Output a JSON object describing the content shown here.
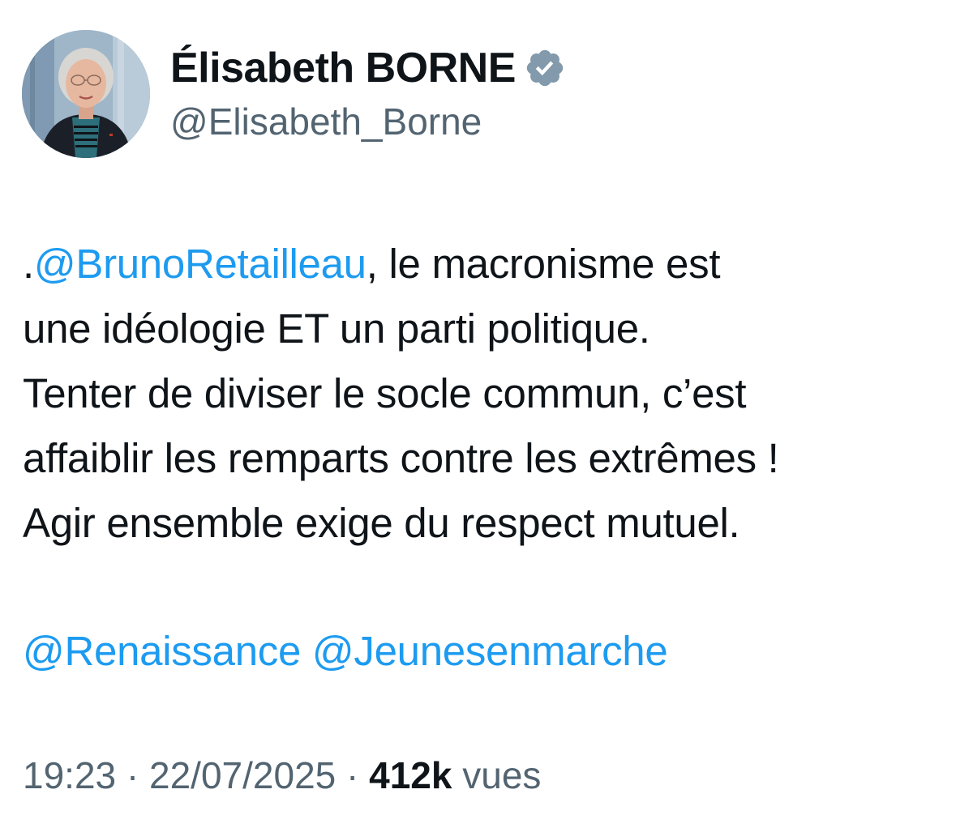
{
  "author": {
    "name": "Élisabeth BORNE",
    "handle": "@Elisabeth_Borne",
    "verified_icon": "verified-badge-icon",
    "verified_color": "#829aab"
  },
  "tweet": {
    "prefix": ".",
    "mention_1": "@BrunoRetailleau",
    "line_1_rest": ", le macronisme est",
    "line_2": "une idéologie ET un parti politique.",
    "line_3": "Tenter de diviser le socle commun, c’est",
    "line_4": "affaiblir les remparts contre les extrêmes !",
    "line_5": "Agir ensemble exige du respect mutuel.",
    "mention_2": "@Renaissance",
    "mention_3": "@Jeunesenmarche"
  },
  "meta": {
    "time": "19:23",
    "separator": "·",
    "date": "22/07/2025",
    "views_count": "412k",
    "views_label": "vues"
  },
  "colors": {
    "mention": "#1d9bf0",
    "text": "#0f1419",
    "secondary": "#536471"
  }
}
